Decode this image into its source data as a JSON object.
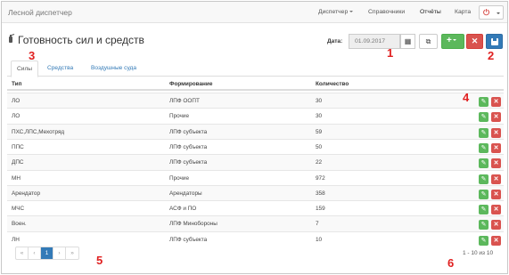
{
  "navbar": {
    "brand": "Лесной диспетчер",
    "items": [
      {
        "label": "Диспетчер",
        "dropdown": true
      },
      {
        "label": "Справочники",
        "dropdown": false
      },
      {
        "label": "Отчёты",
        "dropdown": false
      },
      {
        "label": "Карта",
        "dropdown": false
      }
    ],
    "power_icon": "power-icon"
  },
  "page": {
    "title": "Готовность сил и средств",
    "title_icon": "fire-extinguisher-icon"
  },
  "toolbar": {
    "date_label": "Дата:",
    "date_value": "01.09.2017",
    "calendar_icon": "calendar-icon",
    "copy_icon": "copy-icon",
    "add_icon": "plus-icon",
    "clear_icon": "close-icon",
    "save_icon": "floppy-disk-icon"
  },
  "tabs": [
    {
      "label": "Силы",
      "active": true
    },
    {
      "label": "Средства",
      "active": false
    },
    {
      "label": "Воздушные суда",
      "active": false
    }
  ],
  "table": {
    "headers": {
      "type": "Тип",
      "formation": "Формирование",
      "quantity": "Количество"
    },
    "rows": [
      {
        "type": "ЛО",
        "formation": "ЛПФ ООПТ",
        "quantity": "30"
      },
      {
        "type": "ЛО",
        "formation": "Прочие",
        "quantity": "30"
      },
      {
        "type": "ПХС,ЛПС,Мехотряд",
        "formation": "ЛПФ субъекта",
        "quantity": "59"
      },
      {
        "type": "ППС",
        "formation": "ЛПФ субъекта",
        "quantity": "50"
      },
      {
        "type": "ДПС",
        "formation": "ЛПФ субъекта",
        "quantity": "22"
      },
      {
        "type": "МН",
        "formation": "Прочие",
        "quantity": "972"
      },
      {
        "type": "Арендатор",
        "formation": "Арендаторы",
        "quantity": "358"
      },
      {
        "type": "МЧС",
        "formation": "АСФ и ПО",
        "quantity": "159"
      },
      {
        "type": "Воен.",
        "formation": "ЛПФ Минобороны",
        "quantity": "7"
      },
      {
        "type": "ЛН",
        "formation": "ЛПФ субъекта",
        "quantity": "10"
      }
    ],
    "edit_icon": "pencil-icon",
    "delete_icon": "close-icon"
  },
  "pagination": {
    "first": "«",
    "prev": "‹",
    "current": "1",
    "next": "›",
    "last": "»",
    "summary": "1 - 10 из 10"
  },
  "markers": [
    "1",
    "2",
    "3",
    "4",
    "5",
    "6"
  ],
  "colors": {
    "primary": "#337ab7",
    "success": "#5cb85c",
    "danger": "#d9534f",
    "marker": "#e02020"
  }
}
